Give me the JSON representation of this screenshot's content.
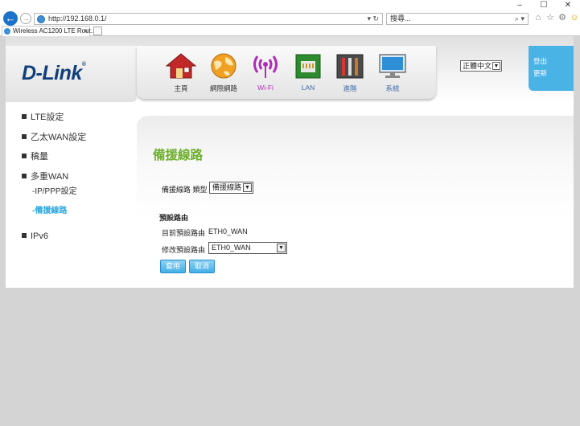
{
  "browser": {
    "address": "http://192.168.0.1/",
    "address_icons": "▾ ↻",
    "search_placeholder": "搜尋...",
    "search_icons": "⌕ ▾",
    "tab_title": "Wireless AC1200 LTE Rout...",
    "tab_close": "×",
    "window_buttons": {
      "minimize": "–",
      "maximize": "☐",
      "close": "✕"
    },
    "nav_back": "←",
    "nav_fwd": "→"
  },
  "header": {
    "logo": "D-Link",
    "logo_mark": "®",
    "nav": [
      {
        "label": "主頁",
        "icon": "home-icon"
      },
      {
        "label": "網際網路",
        "icon": "globe-icon"
      },
      {
        "label": "Wi-Fi",
        "icon": "wifi-icon"
      },
      {
        "label": "LAN",
        "icon": "lan-icon"
      },
      {
        "label": "進階",
        "icon": "tools-icon"
      },
      {
        "label": "系統",
        "icon": "monitor-icon"
      }
    ],
    "language": "正體中文",
    "user_links": [
      "登出",
      "更新"
    ]
  },
  "sidebar": {
    "items": [
      {
        "label": "LTE設定"
      },
      {
        "label": "乙太WAN設定"
      },
      {
        "label": "稿量"
      },
      {
        "label": "多重WAN"
      }
    ],
    "subitems": [
      {
        "label": "-IP/PPP設定"
      },
      {
        "label": "-備援線路"
      }
    ],
    "last_item": "IPv6"
  },
  "main": {
    "title": "備援線路",
    "type_label": "備援線路 類型",
    "type_value": "備援線路",
    "default_route_heading": "預設路由",
    "current_route_label": "目前預設路由",
    "current_route_value": "ETH0_WAN",
    "modify_route_label": "修改預設路由",
    "modify_route_value": "ETH0_WAN",
    "apply_label": "套用",
    "cancel_label": "取消"
  },
  "colors": {
    "accent_blue": "#4ab3e6",
    "title_green": "#6cae2b",
    "logo_navy": "#113f7c",
    "active_sub": "#26a6e0"
  }
}
